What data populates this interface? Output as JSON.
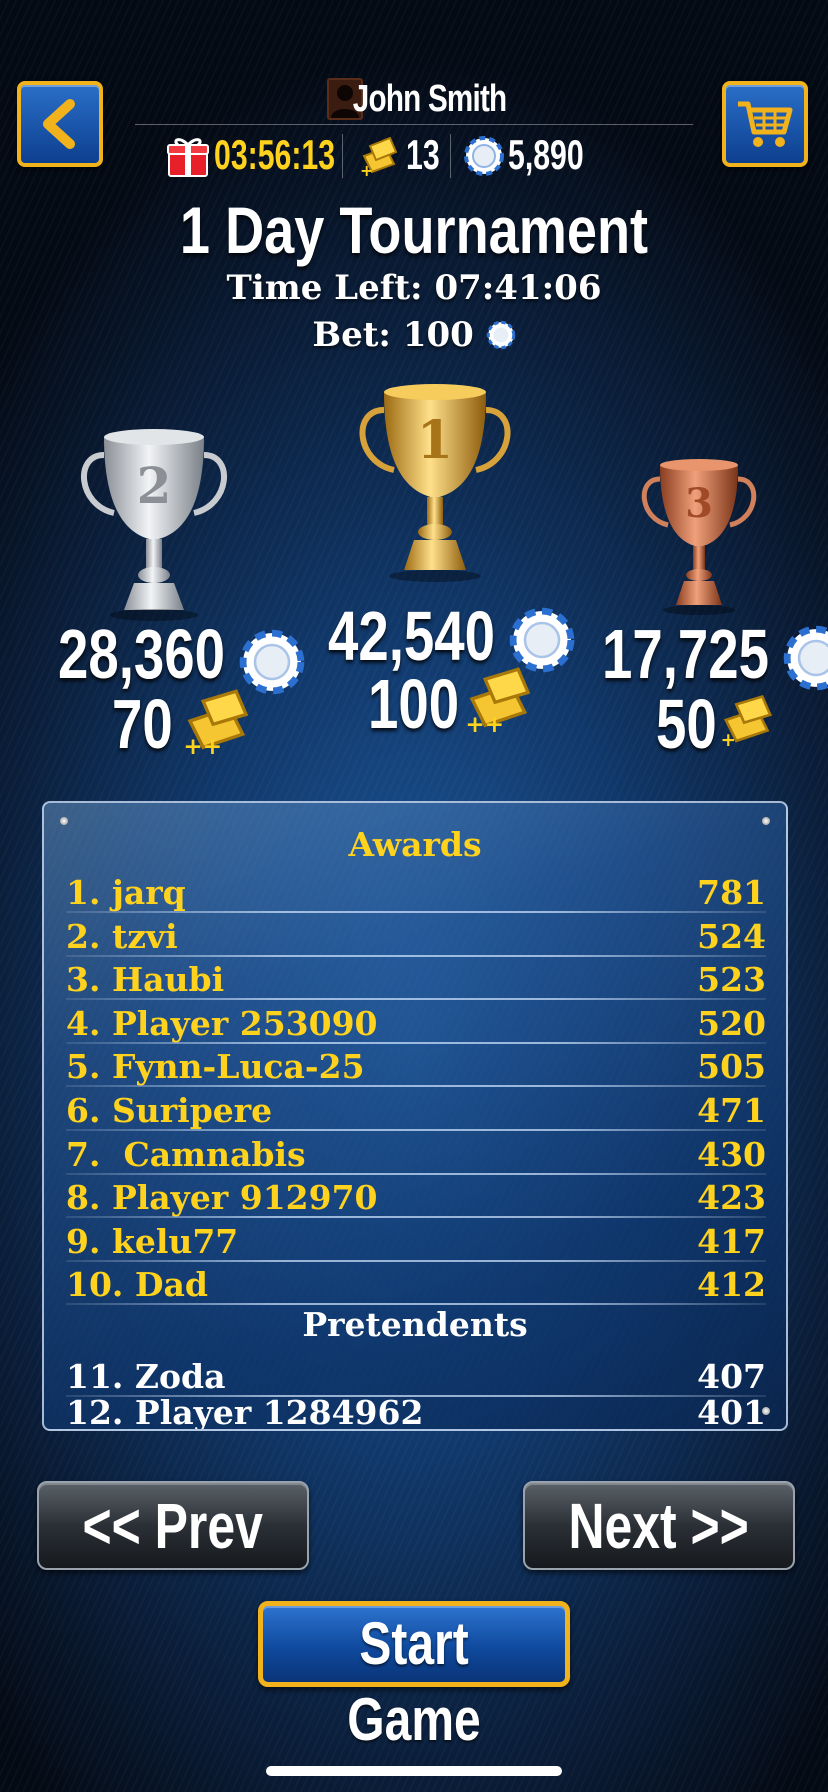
{
  "header": {
    "player_name": "John Smith",
    "gift_timer": "03:56:13",
    "gold_count": "13",
    "chips": "5,890"
  },
  "tournament": {
    "title": "1 Day Tournament",
    "time_left_label": "Time Left:",
    "time_left": "07:41:06",
    "bet_label": "Bet:",
    "bet": "100"
  },
  "prizes": [
    {
      "place": "2",
      "chips": "28,360",
      "gold": "70"
    },
    {
      "place": "1",
      "chips": "42,540",
      "gold": "100"
    },
    {
      "place": "3",
      "chips": "17,725",
      "gold": "50"
    }
  ],
  "leaderboard": {
    "awards_heading": "Awards",
    "awards": [
      {
        "rank": "1.",
        "name": "jarq",
        "score": "781"
      },
      {
        "rank": "2.",
        "name": "tzvi",
        "score": "524"
      },
      {
        "rank": "3.",
        "name": "Haubi",
        "score": "523"
      },
      {
        "rank": "4.",
        "name": "Player 253090",
        "score": "520"
      },
      {
        "rank": "5.",
        "name": "Fynn-Luca-25",
        "score": "505"
      },
      {
        "rank": "6.",
        "name": "Suripere",
        "score": "471"
      },
      {
        "rank": "7.",
        "name": " Camnabis",
        "score": "430"
      },
      {
        "rank": "8.",
        "name": "Player 912970",
        "score": "423"
      },
      {
        "rank": "9.",
        "name": "kelu77",
        "score": "417"
      },
      {
        "rank": "10.",
        "name": "Dad",
        "score": "412"
      }
    ],
    "pretendents_heading": "Pretendents",
    "pretendents": [
      {
        "rank": "11.",
        "name": "Zoda",
        "score": "407"
      },
      {
        "rank": "12.",
        "name": "Player 1284962",
        "score": "401"
      }
    ]
  },
  "buttons": {
    "prev": "<< Prev",
    "next": "Next >>",
    "start": "Start Game"
  },
  "colors": {
    "gold_text": "#ffd21e",
    "button_border": "#f2b21c",
    "bg_blue": "#1f5a9c"
  }
}
